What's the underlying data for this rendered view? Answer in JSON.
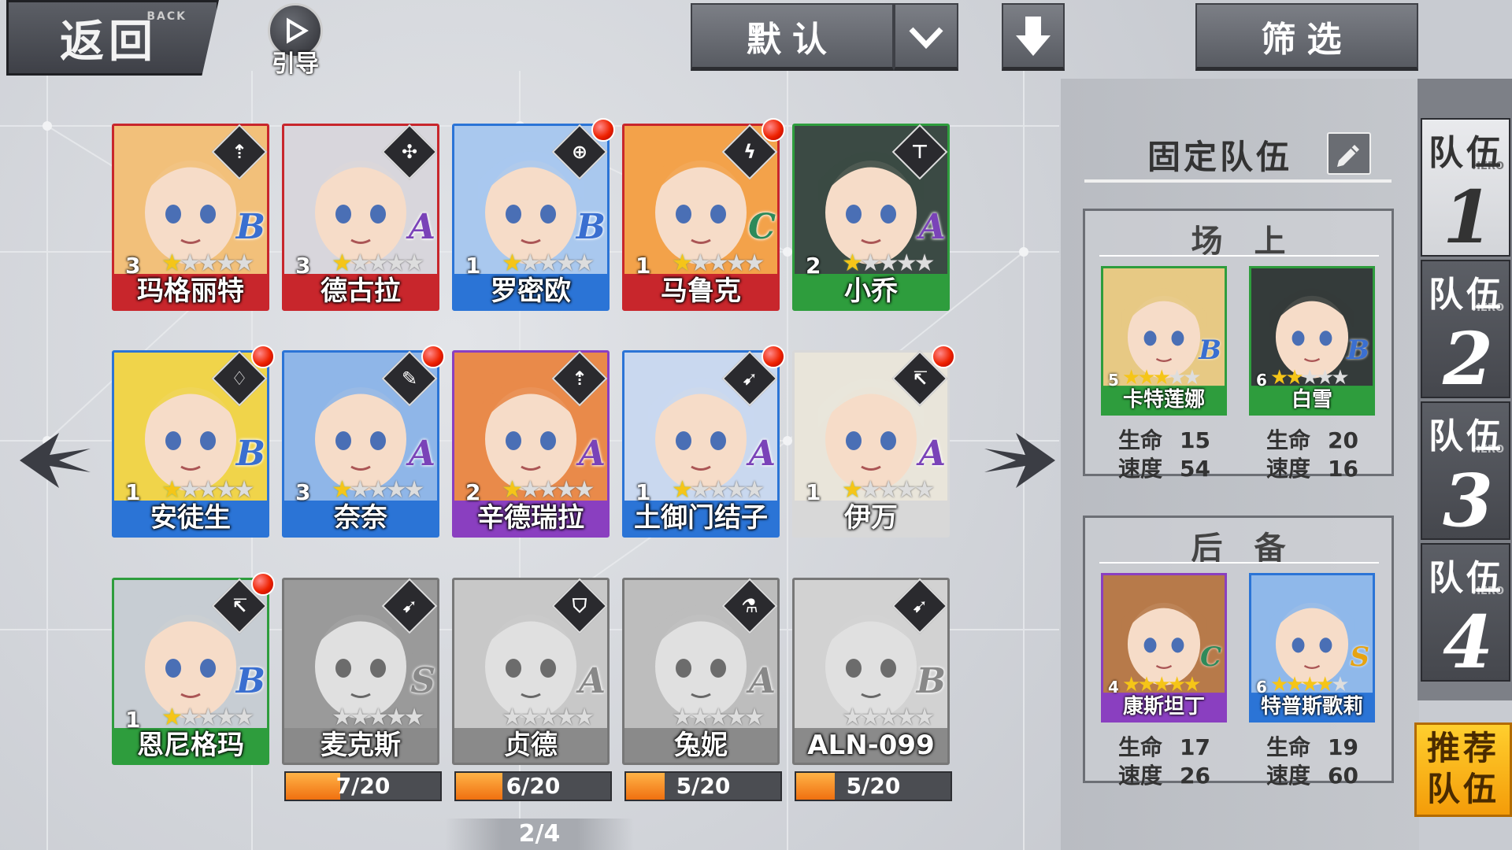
{
  "header": {
    "back_label": "返回",
    "back_en": "BACK",
    "guide_label": "引导",
    "sort_label": "默认",
    "filter_label": "筛选"
  },
  "heroes": [
    {
      "name": "玛格丽特",
      "level": "3",
      "stars": 1,
      "rank": "B",
      "frame": "#c8262c",
      "bg": "#f2c07a",
      "rank_color": "#3a6fd0",
      "class_icon": "spear-icon",
      "class_glyph": "⇡",
      "new": false
    },
    {
      "name": "德古拉",
      "level": "3",
      "stars": 1,
      "rank": "A",
      "frame": "#c8262c",
      "bg": "#d8d6dc",
      "rank_color": "#7a43b8",
      "class_icon": "shuriken-icon",
      "class_glyph": "✣",
      "new": false
    },
    {
      "name": "罗密欧",
      "level": "1",
      "stars": 1,
      "rank": "B",
      "frame": "#2b74d6",
      "bg": "#a9c8ee",
      "rank_color": "#3a6fd0",
      "class_icon": "crosshair-icon",
      "class_glyph": "⊕",
      "new": true
    },
    {
      "name": "马鲁克",
      "level": "1",
      "stars": 1,
      "rank": "C",
      "frame": "#c8262c",
      "bg": "#f3a24a",
      "rank_color": "#2e8a5a",
      "class_icon": "lightning-icon",
      "class_glyph": "ϟ",
      "new": true
    },
    {
      "name": "小乔",
      "level": "2",
      "stars": 1,
      "rank": "A",
      "frame": "#2e9d3d",
      "bg": "#3b4a44",
      "rank_color": "#7a43b8",
      "class_icon": "hammer-icon",
      "class_glyph": "⊤",
      "new": false
    },
    {
      "name": "安徒生",
      "level": "1",
      "stars": 1,
      "rank": "B",
      "frame": "#2b74d6",
      "bg": "#f0d44a",
      "rank_color": "#3a6fd0",
      "class_icon": "mask-icon",
      "class_glyph": "♢",
      "new": true
    },
    {
      "name": "奈奈",
      "level": "3",
      "stars": 1,
      "rank": "A",
      "frame": "#2b74d6",
      "bg": "#8fb6e8",
      "rank_color": "#7a43b8",
      "class_icon": "wand-icon",
      "class_glyph": "✎",
      "new": true
    },
    {
      "name": "辛德瑞拉",
      "level": "2",
      "stars": 1,
      "rank": "A",
      "frame": "#8a3fc0",
      "bg": "#e98a4a",
      "rank_color": "#7a43b8",
      "class_icon": "spear-icon",
      "class_glyph": "⇡",
      "new": false
    },
    {
      "name": "土御门结子",
      "level": "1",
      "stars": 1,
      "rank": "A",
      "frame": "#2b74d6",
      "bg": "#c9d8ef",
      "rank_color": "#7a43b8",
      "class_icon": "bow-icon",
      "class_glyph": "➹",
      "new": true
    },
    {
      "name": "伊万",
      "level": "1",
      "stars": 1,
      "rank": "A",
      "frame": "#d8d8d8",
      "bg": "#e9e5da",
      "rank_color": "#7a43b8",
      "class_icon": "pickaxe-icon",
      "class_glyph": "↸",
      "new": true
    },
    {
      "name": "恩尼格玛",
      "level": "1",
      "stars": 1,
      "rank": "B",
      "frame": "#2e9d3d",
      "bg": "#c7cdd3",
      "rank_color": "#3a6fd0",
      "class_icon": "pickaxe-icon",
      "class_glyph": "↸",
      "new": true
    }
  ],
  "locked_heroes": [
    {
      "name": "麦克斯",
      "rank": "S",
      "bg": "#9a9a9a",
      "class_icon": "bow-icon",
      "class_glyph": "➹",
      "fragments": "7/20",
      "progress": 0.35
    },
    {
      "name": "贞德",
      "rank": "A",
      "bg": "#c8c8c8",
      "class_icon": "shield-icon",
      "class_glyph": "⛉",
      "fragments": "6/20",
      "progress": 0.3
    },
    {
      "name": "兔妮",
      "rank": "A",
      "bg": "#bdbdbd",
      "class_icon": "flask-icon",
      "class_glyph": "⚗",
      "fragments": "5/20",
      "progress": 0.25
    },
    {
      "name": "ALN-099",
      "rank": "B",
      "bg": "#d2d2d2",
      "class_icon": "bow-icon",
      "class_glyph": "➹",
      "fragments": "5/20",
      "progress": 0.25
    }
  ],
  "pagination": {
    "label": "2/4"
  },
  "team": {
    "title": "固定队伍",
    "onfield_title": "场上",
    "reserve_title": "后备",
    "hp_label": "生命",
    "speed_label": "速度",
    "onfield": [
      {
        "name": "卡特莲娜",
        "level": "5",
        "stars": 3,
        "rank": "B",
        "frame": "#2e9d3d",
        "bg": "#e7c984",
        "rank_color": "#3a6fd0",
        "hp": "15",
        "speed": "54"
      },
      {
        "name": "白雪",
        "level": "6",
        "stars": 2,
        "rank": "B",
        "frame": "#2e9d3d",
        "bg": "#343b3a",
        "rank_color": "#3a6fd0",
        "hp": "20",
        "speed": "16"
      }
    ],
    "reserve": [
      {
        "name": "康斯坦丁",
        "level": "4",
        "stars": 5,
        "rank": "C",
        "frame": "#8a3fc0",
        "bg": "#b77a4a",
        "rank_color": "#2e8a5a",
        "hp": "17",
        "speed": "26"
      },
      {
        "name": "特普斯歌莉",
        "level": "6",
        "stars": 4,
        "rank": "S",
        "frame": "#2b74d6",
        "bg": "#8fb8ea",
        "rank_color": "#e6a313",
        "hp": "19",
        "speed": "60"
      }
    ]
  },
  "team_tabs": [
    {
      "label": "队伍",
      "number": "1",
      "active": true
    },
    {
      "label": "队伍",
      "number": "2",
      "active": false
    },
    {
      "label": "队伍",
      "number": "3",
      "active": false
    },
    {
      "label": "队伍",
      "number": "4",
      "active": false
    }
  ],
  "team_tab_en": "HERO",
  "recommend_label": "推荐队伍"
}
